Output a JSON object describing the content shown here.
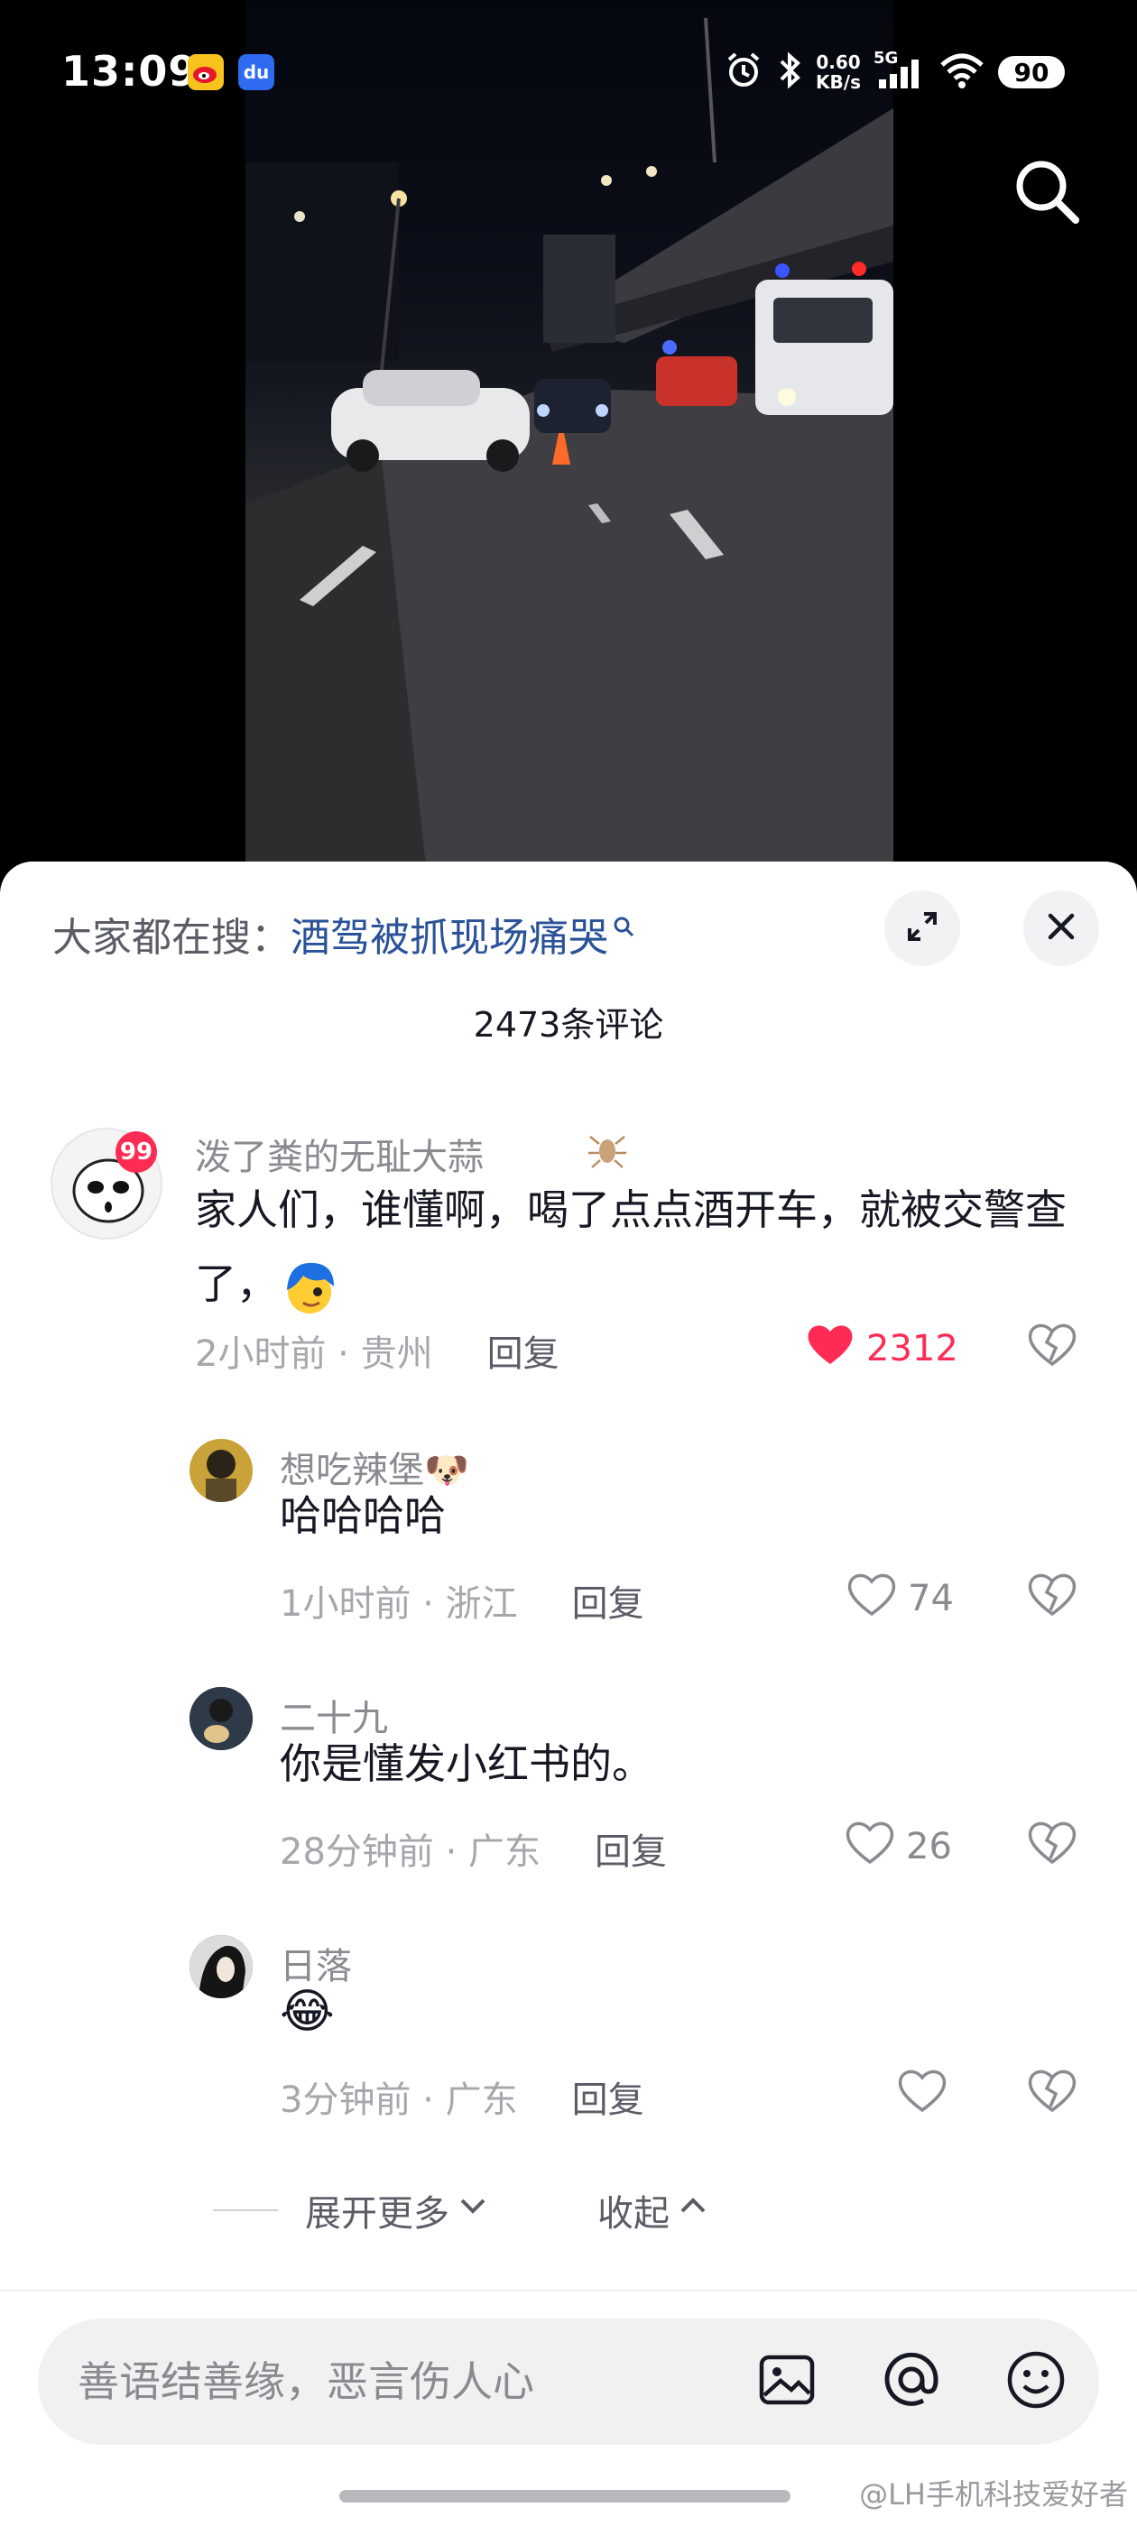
{
  "status_bar": {
    "time": "13:09",
    "app_icons": [
      "weibo-icon",
      "baidu-du-icon"
    ],
    "net_speed_value": "0.60",
    "net_speed_unit": "KB/s",
    "network": "5G",
    "battery": "90"
  },
  "video": {
    "search_icon": "search-icon"
  },
  "comments_panel": {
    "trending_prefix": "大家都在搜：",
    "trending_query": "酒驾被抓现场痛哭",
    "count_label": "2473条评论",
    "comments": [
      {
        "username": "泼了粪的无耻大蒜",
        "badge": "99",
        "text": "家人们，谁懂啊，喝了点点酒开车，就被交警查了，",
        "time_location": "2小时前 · 贵州",
        "reply_label": "回复",
        "likes": "2312",
        "liked": true
      },
      {
        "username": "想吃辣堡🐶",
        "text": "哈哈哈哈",
        "time_location": "1小时前 · 浙江",
        "reply_label": "回复",
        "likes": "74",
        "liked": false
      },
      {
        "username": "二十九",
        "text": "你是懂发小红书的。",
        "time_location": "28分钟前 · 广东",
        "reply_label": "回复",
        "likes": "26",
        "liked": false
      },
      {
        "username": "日落",
        "text": "😂",
        "time_location": "3分钟前 · 广东",
        "reply_label": "回复",
        "likes": "",
        "liked": false
      }
    ],
    "expand_more": "展开更多",
    "collapse": "收起"
  },
  "input_bar": {
    "placeholder": "善语结善缘，恶言伤人心"
  },
  "watermark": "@LH手机科技爱好者",
  "colors": {
    "like_red": "#fe2c55",
    "link_blue": "#2a5298",
    "sheet_bg": "#ffffff"
  }
}
